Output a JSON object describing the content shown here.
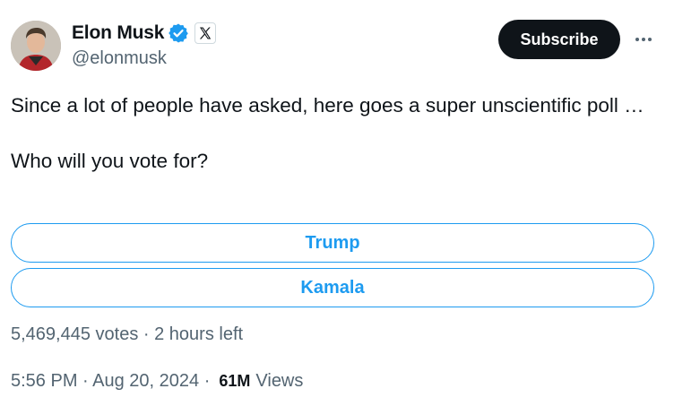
{
  "author": {
    "display_name": "Elon Musk",
    "handle": "@elonmusk",
    "verified": true,
    "affiliate_badge": "X"
  },
  "actions": {
    "subscribe_label": "Subscribe",
    "more_icon": "more-horizontal-icon"
  },
  "tweet": {
    "line1": "Since a lot of people have asked, here goes a super unscientific poll …",
    "line2": "Who will you vote for?"
  },
  "poll": {
    "options": [
      {
        "label": "Trump"
      },
      {
        "label": "Kamala"
      }
    ],
    "meta": "5,469,445 votes · 2 hours left"
  },
  "footer": {
    "timestamp": "5:56 PM · Aug 20, 2024 ·",
    "views_count": "61M",
    "views_label": "Views"
  },
  "colors": {
    "accent": "#1d9bf0",
    "text_primary": "#0f1419",
    "text_secondary": "#536471",
    "button_dark": "#0f1419"
  }
}
